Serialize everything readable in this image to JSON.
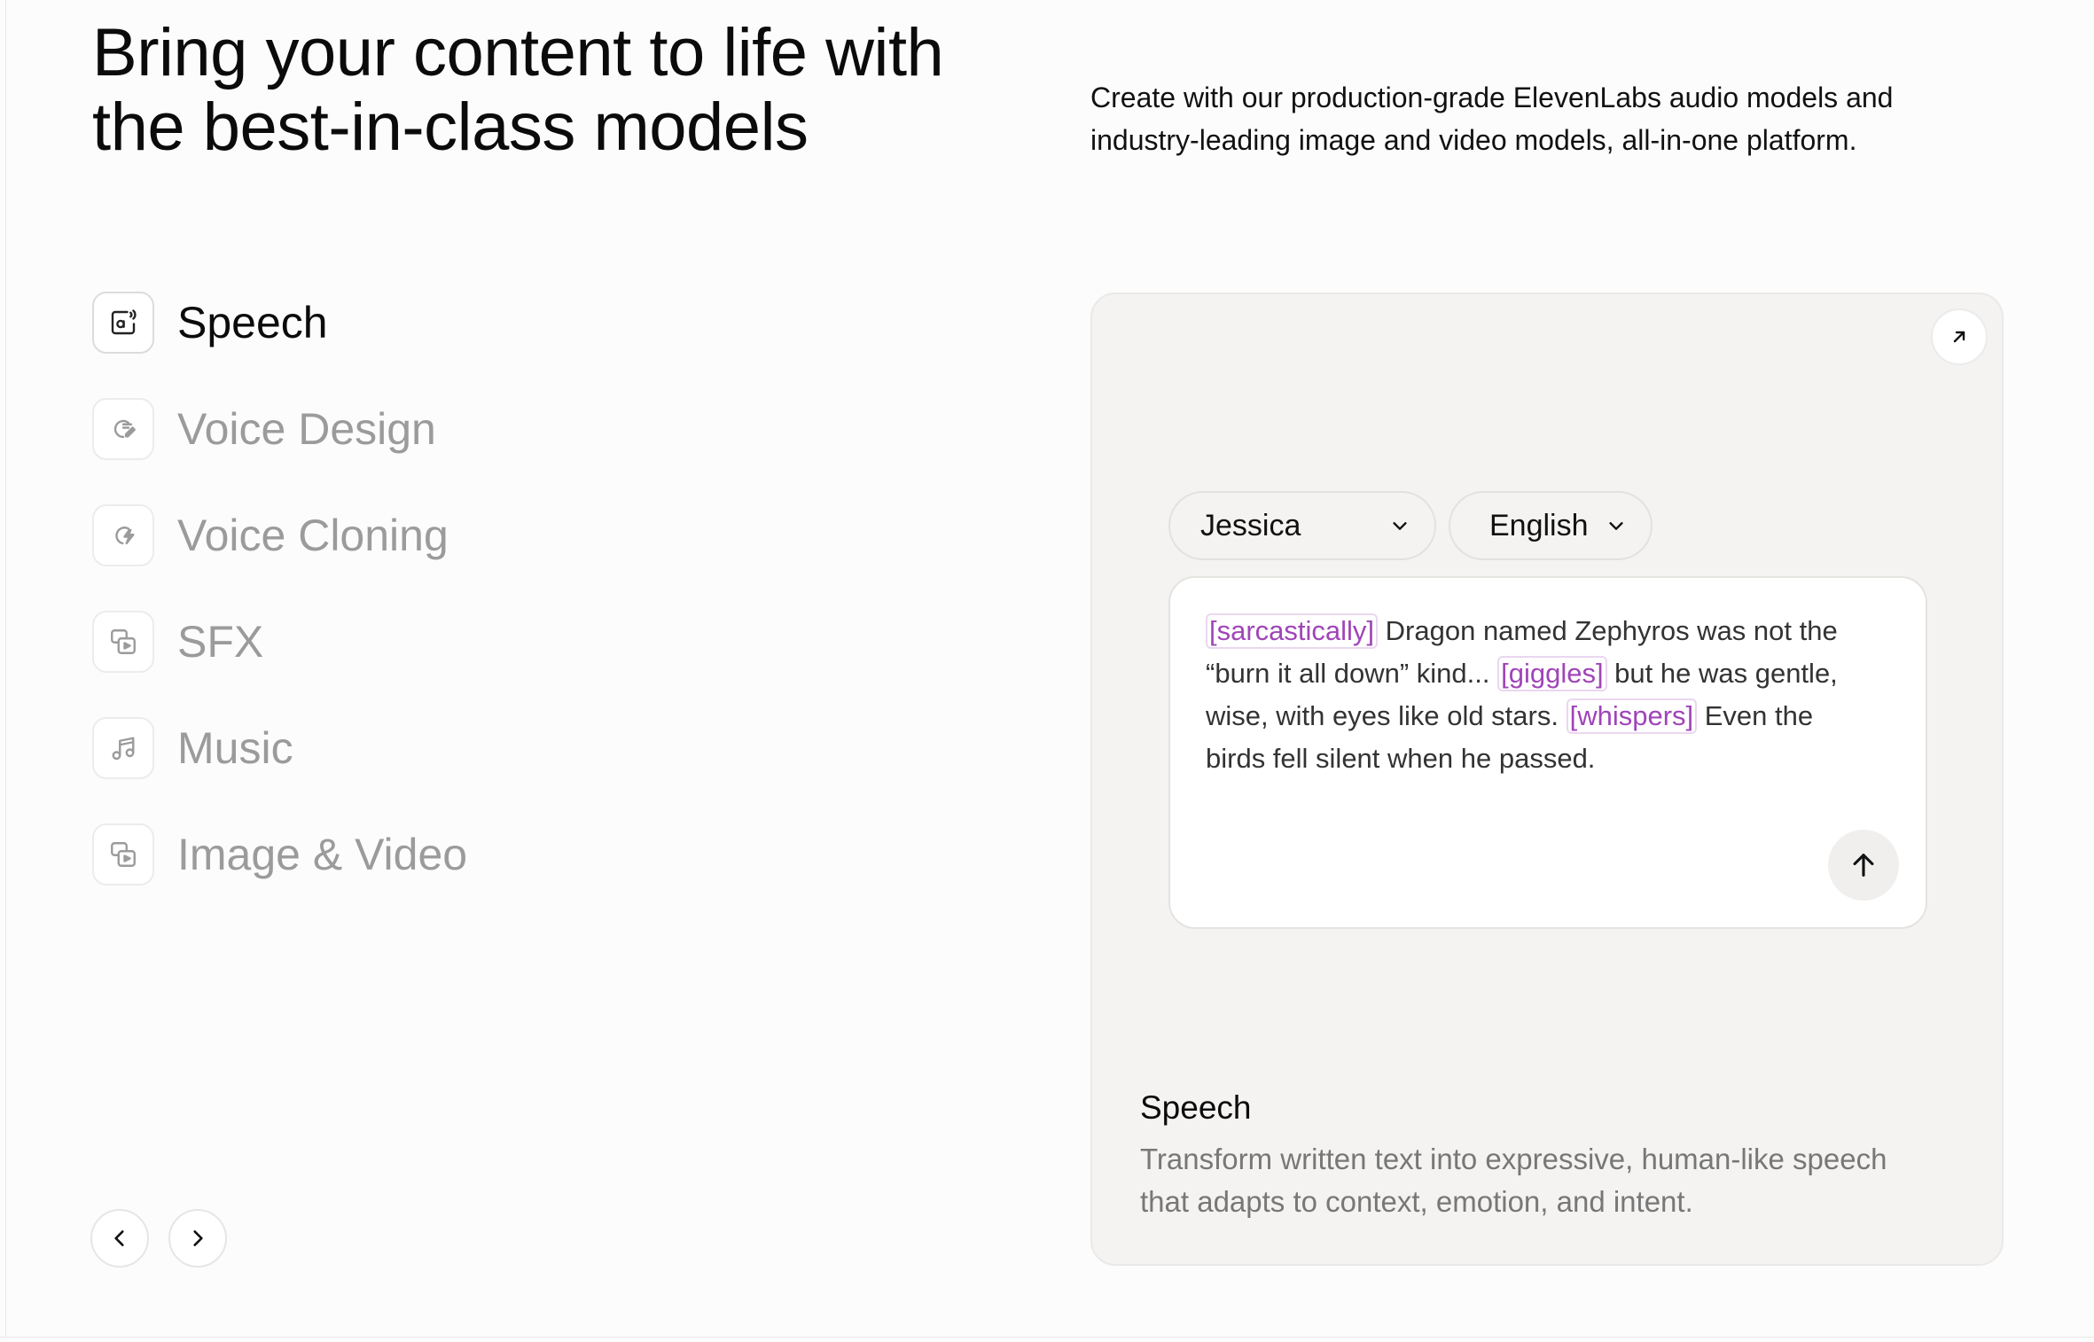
{
  "header": {
    "title_line1": "Bring your content to life with",
    "title_line2": "the best-in-class models",
    "subtitle_line1": "Create with our production-grade ElevenLabs audio models and",
    "subtitle_line2": "industry-leading image and video models, all-in-one platform."
  },
  "nav": {
    "items": [
      {
        "label": "Speech",
        "icon": "speech-icon",
        "active": true
      },
      {
        "label": "Voice Design",
        "icon": "voice-design-icon",
        "active": false
      },
      {
        "label": "Voice Cloning",
        "icon": "voice-cloning-icon",
        "active": false
      },
      {
        "label": "SFX",
        "icon": "sfx-icon",
        "active": false
      },
      {
        "label": "Music",
        "icon": "music-icon",
        "active": false
      },
      {
        "label": "Image & Video",
        "icon": "image-video-icon",
        "active": false
      }
    ]
  },
  "carousel": {
    "prev_icon": "chevron-left-icon",
    "next_icon": "chevron-right-icon"
  },
  "card": {
    "expand_icon": "arrow-up-right-icon",
    "voice_select": "Jessica",
    "language_select": "English",
    "prompt": {
      "tag1": "[sarcastically]",
      "text1": " Dragon named Zephyros was not the “burn it all down” kind... ",
      "tag2": "[giggles]",
      "text2": " but he was gentle, wise, with eyes like old stars. ",
      "tag3": "[whispers]",
      "text3": " Even the birds fell silent when he passed."
    },
    "send_icon": "arrow-up-icon",
    "title": "Speech",
    "description_line1": "Transform written text into expressive, human-like speech",
    "description_line2": "that adapts to context, emotion, and intent."
  },
  "colors": {
    "tag_text": "#a044b8",
    "tag_border": "#ead7f0",
    "card_bg": "#f4f3f2",
    "inactive_nav": "#9b9b9b"
  }
}
